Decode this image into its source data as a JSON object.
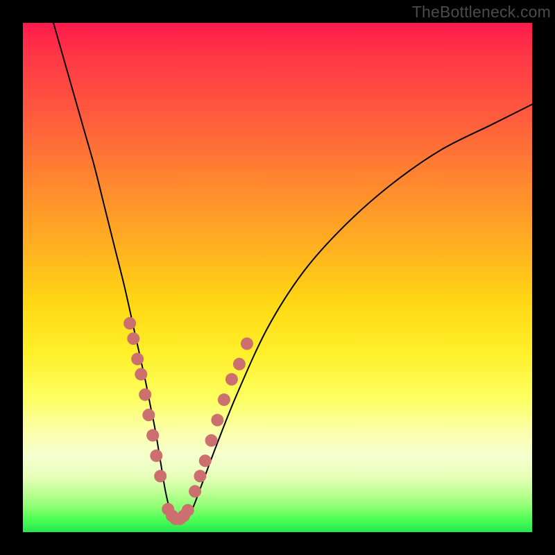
{
  "watermark": "TheBottleneck.com",
  "chart_data": {
    "type": "line",
    "title": "",
    "xlabel": "",
    "ylabel": "",
    "xlim": [
      0,
      100
    ],
    "ylim": [
      0,
      100
    ],
    "series": [
      {
        "name": "bottleneck-curve",
        "x": [
          6,
          8,
          10,
          12,
          14,
          16,
          18,
          20,
          22,
          24,
          25,
          26,
          27,
          28,
          29,
          30,
          31,
          33,
          35,
          38,
          42,
          48,
          55,
          63,
          72,
          82,
          92,
          100
        ],
        "y": [
          100,
          93,
          86,
          79,
          72,
          64,
          56,
          48,
          39,
          30,
          25,
          20,
          14,
          8,
          4,
          2,
          2,
          4,
          9,
          17,
          27,
          40,
          51,
          60,
          68,
          75,
          80,
          84
        ]
      }
    ],
    "markers": [
      {
        "name": "left-cluster",
        "color": "#cc6f6f",
        "points": [
          {
            "x": 21.0,
            "y": 41
          },
          {
            "x": 21.7,
            "y": 38
          },
          {
            "x": 22.5,
            "y": 34
          },
          {
            "x": 23.2,
            "y": 31
          },
          {
            "x": 24.0,
            "y": 27
          },
          {
            "x": 24.7,
            "y": 23
          },
          {
            "x": 25.5,
            "y": 19
          },
          {
            "x": 26.2,
            "y": 15
          },
          {
            "x": 27.0,
            "y": 11
          }
        ]
      },
      {
        "name": "trough-cluster",
        "color": "#cc6f6f",
        "points": [
          {
            "x": 28.5,
            "y": 4.5
          },
          {
            "x": 29.3,
            "y": 3.2
          },
          {
            "x": 30.0,
            "y": 2.6
          },
          {
            "x": 30.8,
            "y": 2.6
          },
          {
            "x": 31.6,
            "y": 3.2
          },
          {
            "x": 32.4,
            "y": 4.3
          }
        ]
      },
      {
        "name": "right-cluster",
        "color": "#cc6f6f",
        "points": [
          {
            "x": 33.8,
            "y": 8
          },
          {
            "x": 34.8,
            "y": 11
          },
          {
            "x": 35.8,
            "y": 14
          },
          {
            "x": 37.0,
            "y": 18
          },
          {
            "x": 38.2,
            "y": 22
          },
          {
            "x": 39.5,
            "y": 26
          },
          {
            "x": 41.0,
            "y": 30
          },
          {
            "x": 42.5,
            "y": 33
          },
          {
            "x": 44.0,
            "y": 37
          }
        ]
      }
    ]
  }
}
